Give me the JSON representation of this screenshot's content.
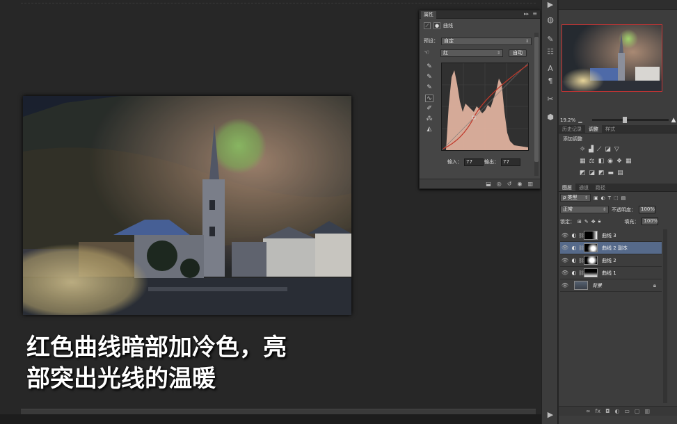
{
  "caption": {
    "line1": "红色曲线暗部加冷色，亮",
    "line2": "部突出光线的温暖"
  },
  "properties_panel": {
    "tab_label": "属性",
    "collapse_icon": "double-chevron-icon",
    "adjustment_name": "曲线",
    "preset_label": "预设：",
    "preset_value": "自定",
    "channel_value": "红",
    "auto_button": "自动",
    "input_label": "输入：",
    "input_value": "77",
    "output_label": "输出：",
    "output_value": "77",
    "curve_color": "#c0392b",
    "histogram_color": "#e8b8a4"
  },
  "navigator": {
    "zoom_value": "19.2%"
  },
  "adjustments_panel": {
    "tabs": [
      "历史记录",
      "调整",
      "样式"
    ],
    "active_tab": "调整",
    "title": "添加调整"
  },
  "layers_panel": {
    "tabs": [
      "图层",
      "通道",
      "路径"
    ],
    "active_tab": "图层",
    "filter_value": "ρ 类型",
    "blend_mode": "正常",
    "opacity_label": "不透明度：",
    "opacity_value": "100%",
    "lock_label": "锁定：",
    "fill_label": "填充：",
    "fill_value": "100%",
    "layers": [
      {
        "name": "曲线 3",
        "selected": false
      },
      {
        "name": "曲线 2 副本",
        "selected": true
      },
      {
        "name": "曲线 2",
        "selected": false
      },
      {
        "name": "曲线 1",
        "selected": false
      },
      {
        "name": "背景",
        "selected": false
      }
    ]
  },
  "colors": {
    "selection": "#566a8a",
    "panel": "#454545",
    "canvas_bg": "#272727"
  }
}
